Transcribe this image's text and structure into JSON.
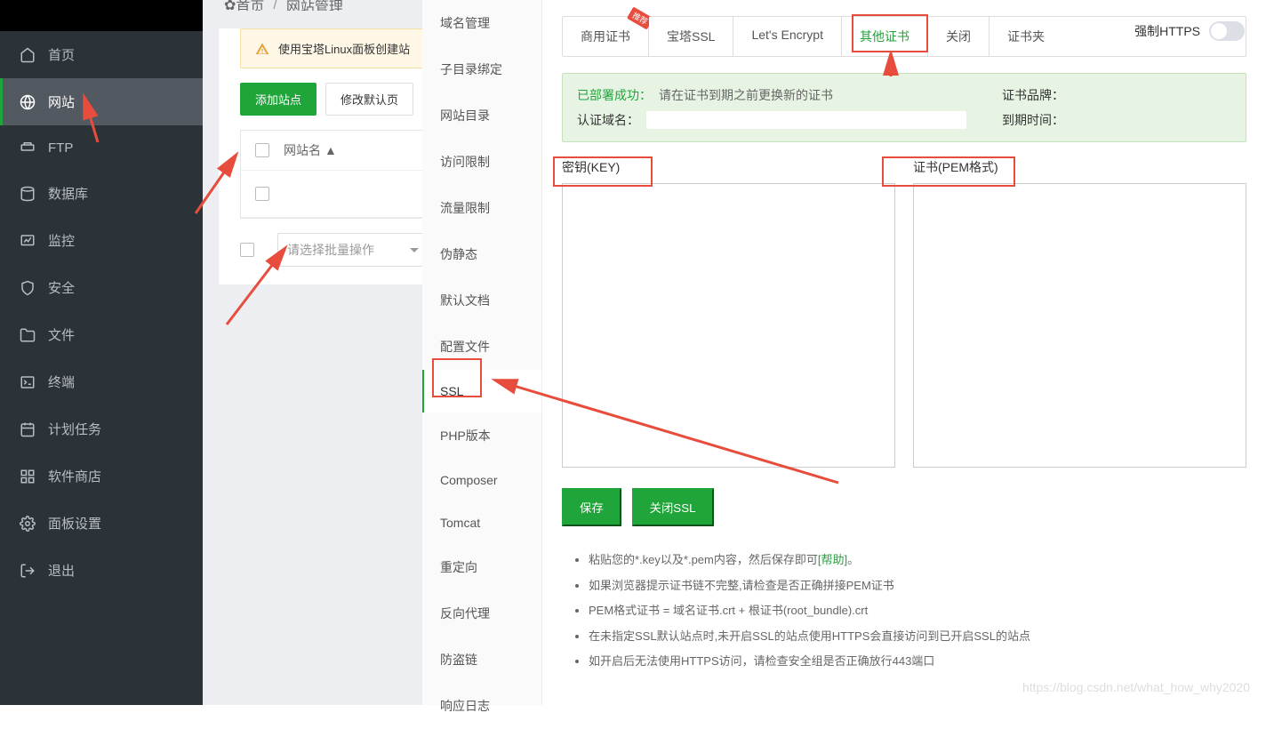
{
  "sidebar": {
    "items": [
      {
        "label": "首页",
        "icon": "home"
      },
      {
        "label": "网站",
        "icon": "globe",
        "active": true
      },
      {
        "label": "FTP",
        "icon": "ftp"
      },
      {
        "label": "数据库",
        "icon": "database"
      },
      {
        "label": "监控",
        "icon": "monitor"
      },
      {
        "label": "安全",
        "icon": "shield"
      },
      {
        "label": "文件",
        "icon": "folder"
      },
      {
        "label": "终端",
        "icon": "terminal"
      },
      {
        "label": "计划任务",
        "icon": "calendar"
      },
      {
        "label": "软件商店",
        "icon": "apps"
      },
      {
        "label": "面板设置",
        "icon": "gear"
      },
      {
        "label": "退出",
        "icon": "exit"
      }
    ]
  },
  "breadcrumb": {
    "home": "首页",
    "current": "网站管理"
  },
  "alert": "使用宝塔Linux面板创建站",
  "toolbar": {
    "add_site": "添加站点",
    "modify_default": "修改默认页"
  },
  "table": {
    "col_name": "网站名"
  },
  "batch": {
    "placeholder": "请选择批量操作"
  },
  "modal_menu": [
    "域名管理",
    "子目录绑定",
    "网站目录",
    "访问限制",
    "流量限制",
    "伪静态",
    "默认文档",
    "配置文件",
    "SSL",
    "PHP版本",
    "Composer",
    "Tomcat",
    "重定向",
    "反向代理",
    "防盗链",
    "响应日志"
  ],
  "modal_menu_active": "SSL",
  "tabs": [
    {
      "label": "商用证书",
      "badge": "推荐"
    },
    {
      "label": "宝塔SSL"
    },
    {
      "label": "Let's Encrypt"
    },
    {
      "label": "其他证书",
      "highlighted": true
    },
    {
      "label": "关闭"
    },
    {
      "label": "证书夹"
    }
  ],
  "force_https": "强制HTTPS",
  "success": {
    "deployed": "已部署成功：",
    "note": "请在证书到期之前更换新的证书",
    "auth_domain": "认证域名：",
    "brand": "证书品牌：",
    "expire": "到期时间："
  },
  "cert": {
    "key_label": "密钥(KEY)",
    "pem_label": "证书(PEM格式)"
  },
  "actions": {
    "save": "保存",
    "close_ssl": "关闭SSL"
  },
  "help": {
    "h1a": "粘贴您的*.key以及*.pem内容，然后保存即可",
    "h1_link": "[帮助]",
    "h1b": "。",
    "h2": "如果浏览器提示证书链不完整,请检查是否正确拼接PEM证书",
    "h3": "PEM格式证书 = 域名证书.crt + 根证书(root_bundle).crt",
    "h4": "在未指定SSL默认站点时,未开启SSL的站点使用HTTPS会直接访问到已开启SSL的站点",
    "h5": "如开启后无法使用HTTPS访问，请检查安全组是否正确放行443端口"
  },
  "watermark": "https://blog.csdn.net/what_how_why2020"
}
